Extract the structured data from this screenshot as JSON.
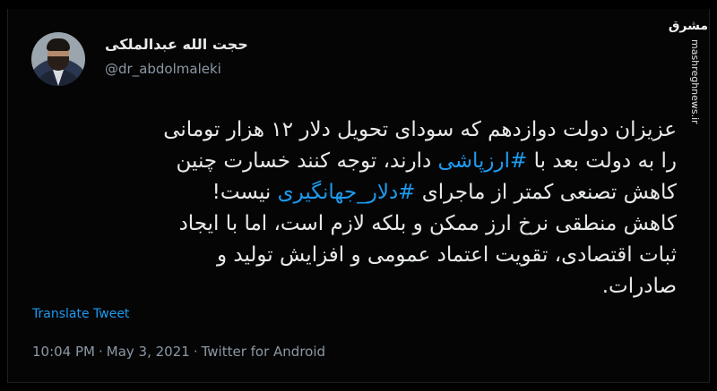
{
  "tweet": {
    "author": {
      "display_name": "حجت الله عبدالملکی",
      "handle": "@dr_abdolmaleki"
    },
    "lines": [
      [
        {
          "t": "عزیزان دولت دوازدهم که سودای تحویل دلار ۱۲ هزار تومانی",
          "h": false
        }
      ],
      [
        {
          "t": "را به دولت بعد با ",
          "h": false
        },
        {
          "t": "#ارزپاشی",
          "h": true
        },
        {
          "t": " دارند، توجه کنند خسارت چنین",
          "h": false
        }
      ],
      [
        {
          "t": "کاهش تصنعی کمتر از ماجرای ",
          "h": false
        },
        {
          "t": "#دلار_جهانگیری",
          "h": true
        },
        {
          "t": " نیست!",
          "h": false
        }
      ],
      [
        {
          "t": "کاهش منطقی نرخ ارز ممکن و بلکه لازم است، اما با ایجاد",
          "h": false
        }
      ],
      [
        {
          "t": "ثبات اقتصادی، تقویت اعتماد عمومی و افزایش تولید و",
          "h": false
        }
      ],
      [
        {
          "t": "صادرات.",
          "h": false
        }
      ]
    ],
    "translate_label": "Translate Tweet",
    "time": "10:04 PM",
    "date": "May 3, 2021",
    "source": "Twitter for Android",
    "separator": "·"
  },
  "watermark": {
    "logo_text": "مشرق",
    "site_text": "mashreghnews.ir"
  },
  "colors": {
    "background": "#000000",
    "text": "#e7e9ea",
    "muted": "#8b98a5",
    "link": "#1d9bf0"
  }
}
